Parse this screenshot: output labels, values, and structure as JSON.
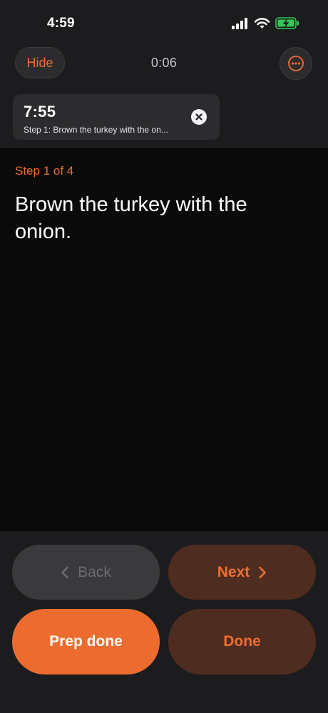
{
  "status_bar": {
    "time": "4:59",
    "icons": [
      "signal-icon",
      "wifi-icon",
      "battery-charging-icon"
    ]
  },
  "header": {
    "hide_label": "Hide",
    "elapsed": "0:06",
    "more_icon": "ellipsis-circle-icon"
  },
  "timer": {
    "time": "7:55",
    "label": "Step 1: Brown the turkey with the on...",
    "close_icon": "close-icon"
  },
  "step": {
    "indicator": "Step 1 of 4",
    "text": "Brown the turkey with the onion."
  },
  "controls": {
    "back_label": "Back",
    "next_label": "Next",
    "prep_done_label": "Prep done",
    "done_label": "Done"
  },
  "colors": {
    "accent": "#ee6e32",
    "background": "#0a0a0b",
    "panel": "#1c1c1e",
    "accent_dark": "#4f2c20",
    "battery_green": "#34c759"
  }
}
